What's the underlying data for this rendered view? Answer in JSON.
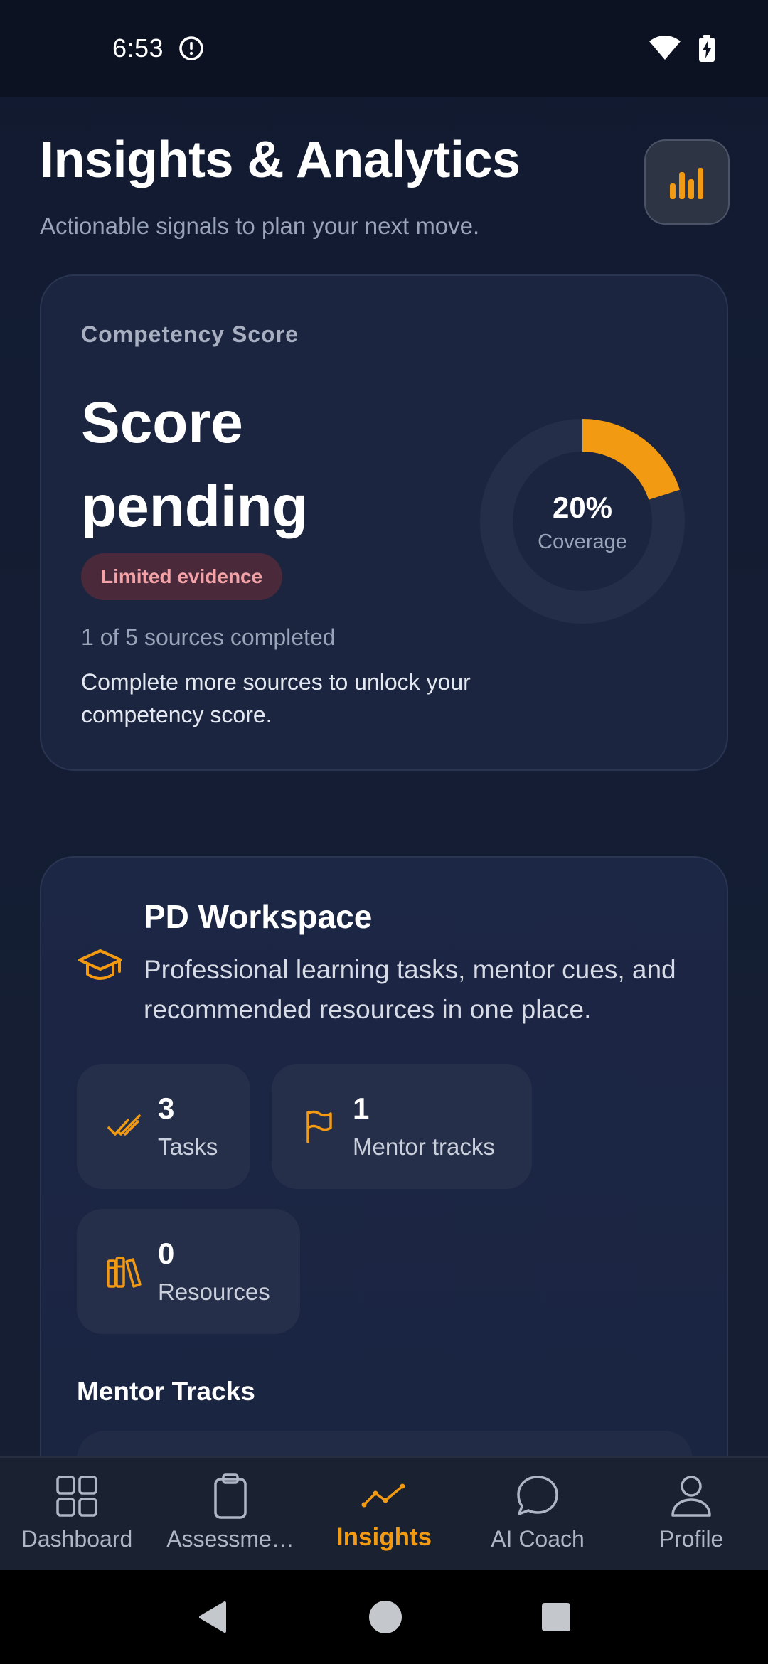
{
  "status": {
    "time": "6:53"
  },
  "header": {
    "title": "Insights & Analytics",
    "subtitle": "Actionable signals to plan your next move."
  },
  "score_card": {
    "label": "Competency Score",
    "value": "Score pending",
    "badge": "Limited evidence",
    "sources": "1 of 5 sources completed",
    "hint": "Complete more sources to unlock your competency score.",
    "coverage_percent": "20%",
    "coverage_fraction": 0.2,
    "coverage_caption": "Coverage"
  },
  "pd_workspace": {
    "title": "PD Workspace",
    "description": "Professional learning tasks, mentor cues, and recommended resources in one place.",
    "stats": [
      {
        "value": "3",
        "label": "Tasks",
        "icon": "double-check-icon"
      },
      {
        "value": "1",
        "label": "Mentor tracks",
        "icon": "flag-icon"
      },
      {
        "value": "0",
        "label": "Resources",
        "icon": "books-icon"
      }
    ],
    "section_title": "Mentor Tracks"
  },
  "bottom_nav": [
    {
      "label": "Dashboard",
      "icon": "grid-icon"
    },
    {
      "label": "Assessme…",
      "icon": "clipboard-icon"
    },
    {
      "label": "Insights",
      "icon": "trend-icon",
      "active": true
    },
    {
      "label": "AI Coach",
      "icon": "chat-bubble-icon"
    },
    {
      "label": "Profile",
      "icon": "user-icon"
    }
  ],
  "colors": {
    "accent": "#f29a12",
    "background": "#111a30",
    "card": "#1b2540",
    "badge_bg": "#4a2a3a",
    "badge_text": "#f3a3a8"
  }
}
